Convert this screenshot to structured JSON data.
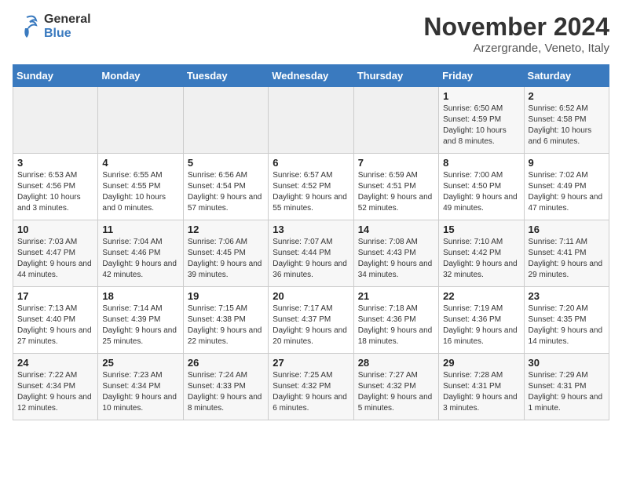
{
  "logo": {
    "general": "General",
    "blue": "Blue"
  },
  "title": "November 2024",
  "location": "Arzergrande, Veneto, Italy",
  "days_of_week": [
    "Sunday",
    "Monday",
    "Tuesday",
    "Wednesday",
    "Thursday",
    "Friday",
    "Saturday"
  ],
  "weeks": [
    [
      {
        "day": "",
        "info": ""
      },
      {
        "day": "",
        "info": ""
      },
      {
        "day": "",
        "info": ""
      },
      {
        "day": "",
        "info": ""
      },
      {
        "day": "",
        "info": ""
      },
      {
        "day": "1",
        "info": "Sunrise: 6:50 AM\nSunset: 4:59 PM\nDaylight: 10 hours and 8 minutes."
      },
      {
        "day": "2",
        "info": "Sunrise: 6:52 AM\nSunset: 4:58 PM\nDaylight: 10 hours and 6 minutes."
      }
    ],
    [
      {
        "day": "3",
        "info": "Sunrise: 6:53 AM\nSunset: 4:56 PM\nDaylight: 10 hours and 3 minutes."
      },
      {
        "day": "4",
        "info": "Sunrise: 6:55 AM\nSunset: 4:55 PM\nDaylight: 10 hours and 0 minutes."
      },
      {
        "day": "5",
        "info": "Sunrise: 6:56 AM\nSunset: 4:54 PM\nDaylight: 9 hours and 57 minutes."
      },
      {
        "day": "6",
        "info": "Sunrise: 6:57 AM\nSunset: 4:52 PM\nDaylight: 9 hours and 55 minutes."
      },
      {
        "day": "7",
        "info": "Sunrise: 6:59 AM\nSunset: 4:51 PM\nDaylight: 9 hours and 52 minutes."
      },
      {
        "day": "8",
        "info": "Sunrise: 7:00 AM\nSunset: 4:50 PM\nDaylight: 9 hours and 49 minutes."
      },
      {
        "day": "9",
        "info": "Sunrise: 7:02 AM\nSunset: 4:49 PM\nDaylight: 9 hours and 47 minutes."
      }
    ],
    [
      {
        "day": "10",
        "info": "Sunrise: 7:03 AM\nSunset: 4:47 PM\nDaylight: 9 hours and 44 minutes."
      },
      {
        "day": "11",
        "info": "Sunrise: 7:04 AM\nSunset: 4:46 PM\nDaylight: 9 hours and 42 minutes."
      },
      {
        "day": "12",
        "info": "Sunrise: 7:06 AM\nSunset: 4:45 PM\nDaylight: 9 hours and 39 minutes."
      },
      {
        "day": "13",
        "info": "Sunrise: 7:07 AM\nSunset: 4:44 PM\nDaylight: 9 hours and 36 minutes."
      },
      {
        "day": "14",
        "info": "Sunrise: 7:08 AM\nSunset: 4:43 PM\nDaylight: 9 hours and 34 minutes."
      },
      {
        "day": "15",
        "info": "Sunrise: 7:10 AM\nSunset: 4:42 PM\nDaylight: 9 hours and 32 minutes."
      },
      {
        "day": "16",
        "info": "Sunrise: 7:11 AM\nSunset: 4:41 PM\nDaylight: 9 hours and 29 minutes."
      }
    ],
    [
      {
        "day": "17",
        "info": "Sunrise: 7:13 AM\nSunset: 4:40 PM\nDaylight: 9 hours and 27 minutes."
      },
      {
        "day": "18",
        "info": "Sunrise: 7:14 AM\nSunset: 4:39 PM\nDaylight: 9 hours and 25 minutes."
      },
      {
        "day": "19",
        "info": "Sunrise: 7:15 AM\nSunset: 4:38 PM\nDaylight: 9 hours and 22 minutes."
      },
      {
        "day": "20",
        "info": "Sunrise: 7:17 AM\nSunset: 4:37 PM\nDaylight: 9 hours and 20 minutes."
      },
      {
        "day": "21",
        "info": "Sunrise: 7:18 AM\nSunset: 4:36 PM\nDaylight: 9 hours and 18 minutes."
      },
      {
        "day": "22",
        "info": "Sunrise: 7:19 AM\nSunset: 4:36 PM\nDaylight: 9 hours and 16 minutes."
      },
      {
        "day": "23",
        "info": "Sunrise: 7:20 AM\nSunset: 4:35 PM\nDaylight: 9 hours and 14 minutes."
      }
    ],
    [
      {
        "day": "24",
        "info": "Sunrise: 7:22 AM\nSunset: 4:34 PM\nDaylight: 9 hours and 12 minutes."
      },
      {
        "day": "25",
        "info": "Sunrise: 7:23 AM\nSunset: 4:34 PM\nDaylight: 9 hours and 10 minutes."
      },
      {
        "day": "26",
        "info": "Sunrise: 7:24 AM\nSunset: 4:33 PM\nDaylight: 9 hours and 8 minutes."
      },
      {
        "day": "27",
        "info": "Sunrise: 7:25 AM\nSunset: 4:32 PM\nDaylight: 9 hours and 6 minutes."
      },
      {
        "day": "28",
        "info": "Sunrise: 7:27 AM\nSunset: 4:32 PM\nDaylight: 9 hours and 5 minutes."
      },
      {
        "day": "29",
        "info": "Sunrise: 7:28 AM\nSunset: 4:31 PM\nDaylight: 9 hours and 3 minutes."
      },
      {
        "day": "30",
        "info": "Sunrise: 7:29 AM\nSunset: 4:31 PM\nDaylight: 9 hours and 1 minute."
      }
    ]
  ]
}
